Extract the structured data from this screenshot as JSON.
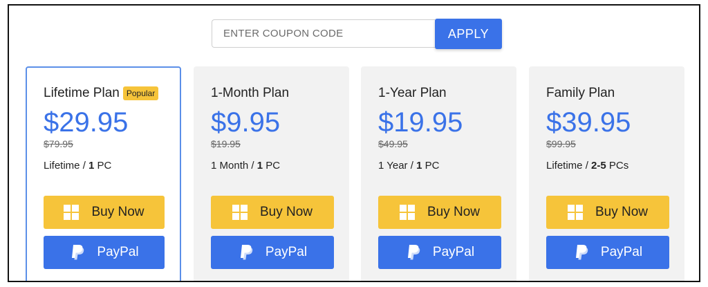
{
  "coupon": {
    "placeholder": "ENTER COUPON CODE",
    "apply_label": "APPLY"
  },
  "plans": [
    {
      "name": "Lifetime Plan",
      "badge": "Popular",
      "price": "$29.95",
      "old_price": "$79.95",
      "term_prefix": "Lifetime / ",
      "term_bold": "1",
      "term_suffix": " PC",
      "buy_label": "Buy Now",
      "paypal_label": "PayPal"
    },
    {
      "name": "1-Month Plan",
      "price": "$9.95",
      "old_price": "$19.95",
      "term_prefix": "1 Month / ",
      "term_bold": "1",
      "term_suffix": " PC",
      "buy_label": "Buy Now",
      "paypal_label": "PayPal"
    },
    {
      "name": "1-Year Plan",
      "price": "$19.95",
      "old_price": "$49.95",
      "term_prefix": "1 Year / ",
      "term_bold": "1",
      "term_suffix": " PC",
      "buy_label": "Buy Now",
      "paypal_label": "PayPal"
    },
    {
      "name": "Family Plan",
      "price": "$39.95",
      "old_price": "$99.95",
      "term_prefix": "Lifetime / ",
      "term_bold": "2-5",
      "term_suffix": " PCs",
      "buy_label": "Buy Now",
      "paypal_label": "PayPal"
    }
  ],
  "icons": {
    "buy": "windows-icon",
    "paypal": "paypal-icon"
  },
  "colors": {
    "accent": "#3a72e8",
    "buy": "#f6c43a",
    "card_bg": "#f2f2f2",
    "featured_border": "#5b8fe8"
  }
}
